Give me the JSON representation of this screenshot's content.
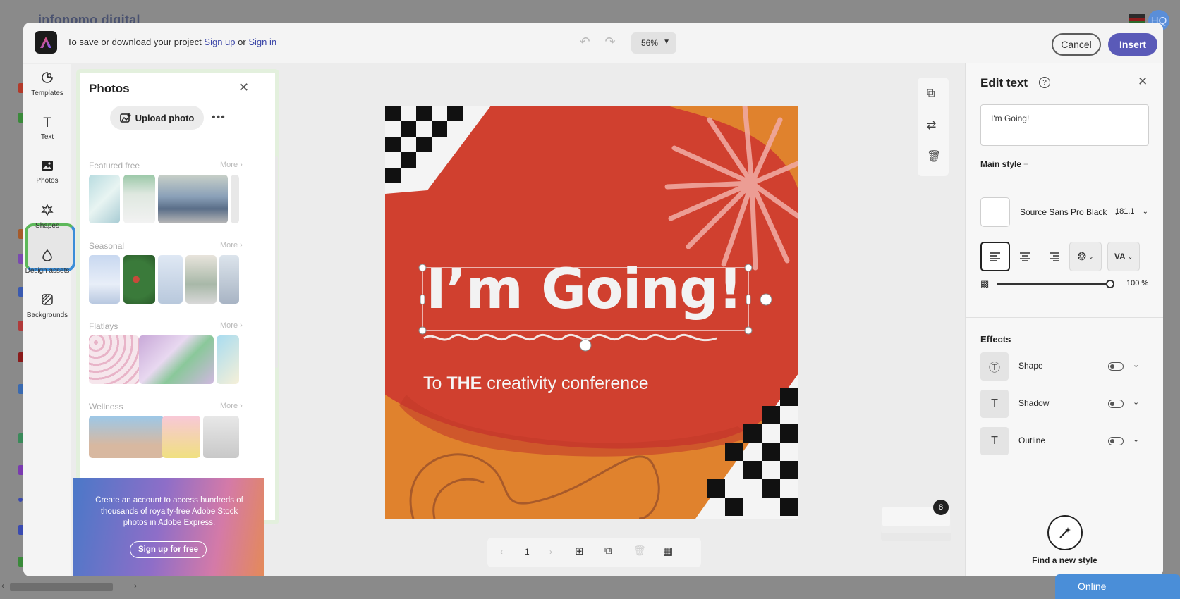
{
  "background": {
    "logo_text": "infonomo digital",
    "avatar_text": "HQ"
  },
  "topbar": {
    "save_prefix": "To save or download your project",
    "sign_up": "Sign up",
    "or": "or",
    "sign_in": "Sign in",
    "zoom": "56%",
    "cancel": "Cancel",
    "insert": "Insert"
  },
  "rail": [
    {
      "label": "Templates",
      "icon": "templates-icon"
    },
    {
      "label": "Text",
      "icon": "text-icon"
    },
    {
      "label": "Photos",
      "icon": "photos-icon"
    },
    {
      "label": "Shapes",
      "icon": "shapes-icon"
    },
    {
      "label": "Design assets",
      "icon": "design-assets-icon"
    },
    {
      "label": "Backgrounds",
      "icon": "backgrounds-icon"
    }
  ],
  "photos": {
    "title": "Photos",
    "upload": "Upload photo",
    "sections": [
      {
        "title": "Featured free",
        "more": "More ›"
      },
      {
        "title": "Seasonal",
        "more": "More ›"
      },
      {
        "title": "Flatlays",
        "more": "More ›"
      },
      {
        "title": "Wellness",
        "more": "More ›"
      }
    ],
    "promo_text": "Create an account to access hundreds of thousands of royalty-free Adobe Stock photos in Adobe Express.",
    "promo_button": "Sign up for free"
  },
  "canvas": {
    "headline": "I’m Going!",
    "subline_pre": "To ",
    "subline_bold": "THE",
    "subline_post": " creativity conference",
    "page_number": "1",
    "page_count_badge": "8"
  },
  "edit_text": {
    "title": "Edit text",
    "text_value": "I'm Going!",
    "main_style": "Main style",
    "font": "Source Sans Pro Black",
    "font_size": "181.1",
    "opacity": "100 %",
    "effects_title": "Effects",
    "effects": [
      {
        "label": "Shape"
      },
      {
        "label": "Shadow"
      },
      {
        "label": "Outline"
      }
    ],
    "find_style": "Find a new style"
  },
  "status": {
    "online": "Online"
  },
  "colors": {
    "accent": "#5a5ab8",
    "artboard_red": "#d0402f",
    "artboard_orange": "#e0822d"
  }
}
